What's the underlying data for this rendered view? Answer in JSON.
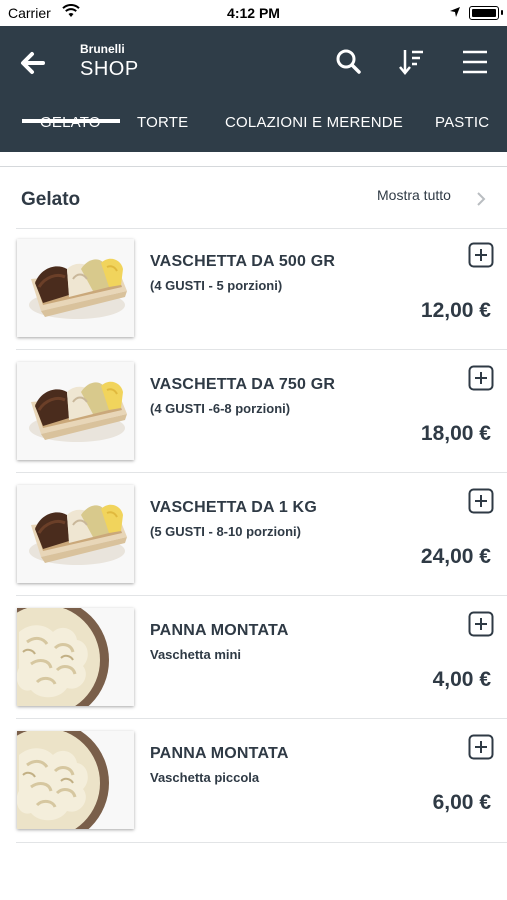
{
  "status_bar": {
    "carrier": "Carrier",
    "time": "4:12 PM"
  },
  "header": {
    "brand": "Brunelli",
    "title": "SHOP"
  },
  "tabs": [
    {
      "label": "GELATO"
    },
    {
      "label": "TORTE"
    },
    {
      "label": "COLAZIONI E MERENDE"
    },
    {
      "label": "PASTIC"
    }
  ],
  "section": {
    "title": "Gelato",
    "show_all": "Mostra tutto"
  },
  "products": [
    {
      "name": "VASCHETTA DA 500 GR",
      "desc": "(4 GUSTI - 5 porzioni)",
      "price": "12,00 €",
      "image": "gelato-tray"
    },
    {
      "name": "VASCHETTA DA 750 GR",
      "desc": "(4 GUSTI -6-8 porzioni)",
      "price": "18,00 €",
      "image": "gelato-tray"
    },
    {
      "name": "VASCHETTA DA 1 KG",
      "desc": "(5 GUSTI - 8-10 porzioni)",
      "price": "24,00 €",
      "image": "gelato-tray"
    },
    {
      "name": "PANNA MONTATA",
      "desc": "Vaschetta mini",
      "price": "4,00 €",
      "image": "whipped-cream"
    },
    {
      "name": "PANNA MONTATA",
      "desc": "Vaschetta piccola",
      "price": "6,00 €",
      "image": "whipped-cream"
    }
  ],
  "colors": {
    "header_bg": "#2f3d48",
    "text": "#2f3a45"
  }
}
